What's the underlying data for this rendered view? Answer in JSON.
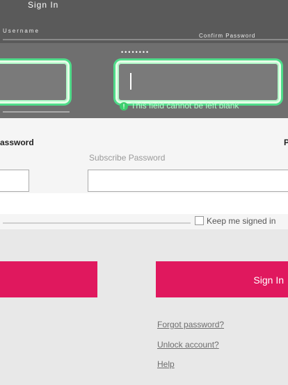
{
  "header": {
    "title": "Sign In",
    "left_label": "Username",
    "right_label": "Confirm Password",
    "dots": "••••••••"
  },
  "fields": {
    "error": "This field cannot be left blank"
  },
  "password": {
    "label_left": "assword",
    "label_right": "P",
    "placeholder": "Subscribe Password"
  },
  "keep_signed_in": {
    "label": "Keep me signed in"
  },
  "buttons": {
    "sign_in": "Sign In"
  },
  "links": {
    "forgot": "Forgot password?",
    "unlock": "Unlock account?",
    "help": "Help"
  },
  "colors": {
    "accent": "#e0185e",
    "error_glow": "#4fdc8a"
  }
}
